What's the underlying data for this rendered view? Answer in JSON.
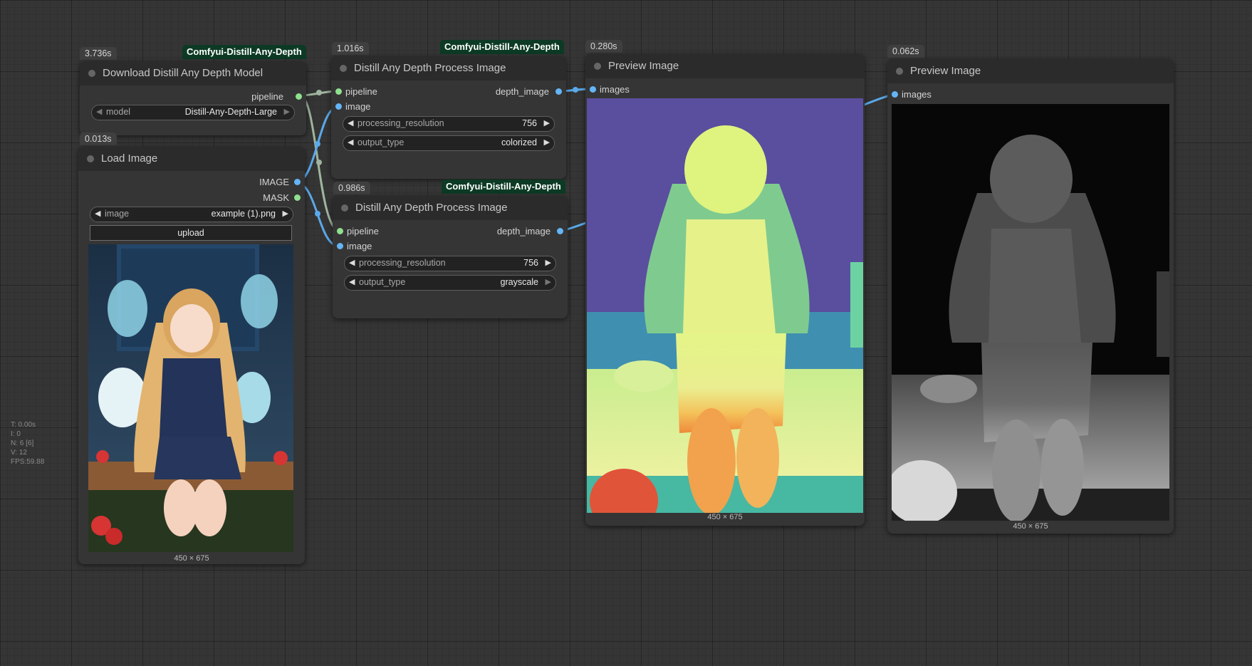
{
  "stats": [
    "T: 0.00s",
    "I: 0",
    "N: 6 [6]",
    "V: 12",
    "FPS:59.88"
  ],
  "nodes": {
    "download": {
      "time": "3.736s",
      "source": "Comfyui-Distill-Any-Depth",
      "title": "Download Distill Any Depth Model",
      "output": "pipeline",
      "widget_label": "model",
      "widget_value": "Distill-Any-Depth-Large"
    },
    "load": {
      "time": "0.013s",
      "title": "Load Image",
      "outputs": [
        "IMAGE",
        "MASK"
      ],
      "widget_label": "image",
      "widget_value": "example (1).png",
      "upload": "upload",
      "dims": "450 × 675"
    },
    "process1": {
      "time": "1.016s",
      "source": "Comfyui-Distill-Any-Depth",
      "title": "Distill Any Depth Process Image",
      "inputs": [
        "pipeline",
        "image"
      ],
      "output": "depth_image",
      "res_label": "processing_resolution",
      "res_value": "756",
      "type_label": "output_type",
      "type_value": "colorized"
    },
    "process2": {
      "time": "0.986s",
      "source": "Comfyui-Distill-Any-Depth",
      "title": "Distill Any Depth Process Image",
      "inputs": [
        "pipeline",
        "image"
      ],
      "output": "depth_image",
      "res_label": "processing_resolution",
      "res_value": "756",
      "type_label": "output_type",
      "type_value": "grayscale"
    },
    "preview1": {
      "time": "0.280s",
      "title": "Preview Image",
      "input": "images",
      "dims": "450 × 675"
    },
    "preview2": {
      "time": "0.062s",
      "title": "Preview Image",
      "input": "images",
      "dims": "450 × 675"
    }
  },
  "colors": {
    "pipeline_socket": "#8fe08f",
    "image_socket": "#64b5f6",
    "source_badge": "#0d3a24",
    "canvas": "#353535"
  }
}
